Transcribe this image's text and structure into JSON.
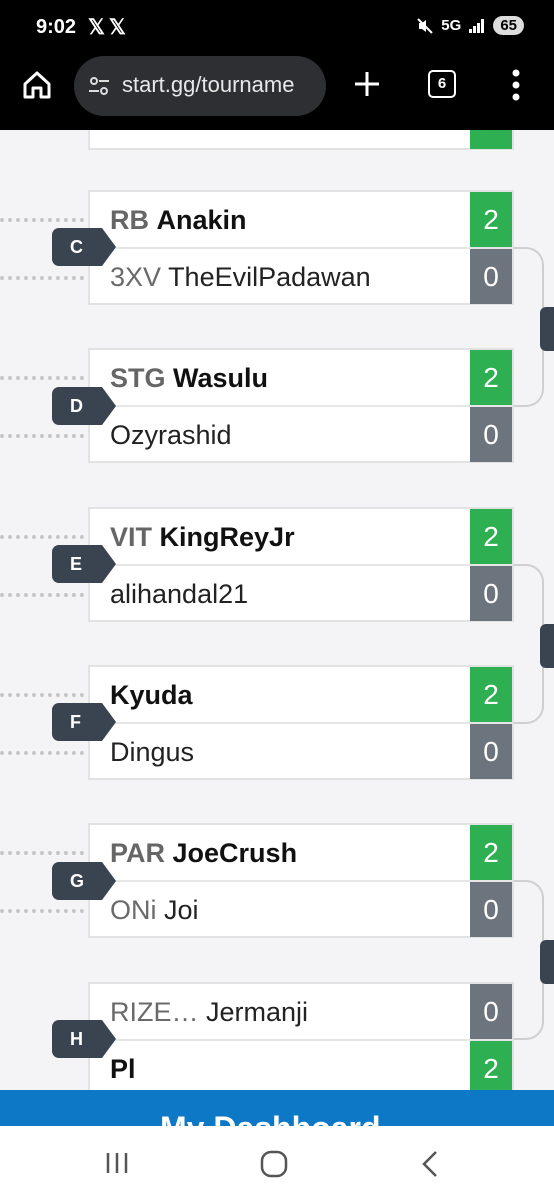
{
  "status_bar": {
    "time": "9:02",
    "x_icons": "𝕏𝕏",
    "network": "5G",
    "battery": "65"
  },
  "browser": {
    "url": "start.gg/tourname",
    "tab_count": "6"
  },
  "matches": [
    {
      "label": "C",
      "p1": {
        "sponsor": "RB",
        "name": "Anakin",
        "score": "2",
        "winner": true
      },
      "p2": {
        "sponsor": "3XV",
        "name": "TheEvilPadawan",
        "score": "0",
        "winner": false
      }
    },
    {
      "label": "D",
      "p1": {
        "sponsor": "STG",
        "name": "Wasulu",
        "score": "2",
        "winner": true
      },
      "p2": {
        "sponsor": "",
        "name": "Ozyrashid",
        "score": "0",
        "winner": false
      }
    },
    {
      "label": "E",
      "p1": {
        "sponsor": "VIT",
        "name": "KingReyJr",
        "score": "2",
        "winner": true
      },
      "p2": {
        "sponsor": "",
        "name": "alihandal21",
        "score": "0",
        "winner": false
      }
    },
    {
      "label": "F",
      "p1": {
        "sponsor": "",
        "name": "Kyuda",
        "score": "2",
        "winner": true
      },
      "p2": {
        "sponsor": "",
        "name": "Dingus",
        "score": "0",
        "winner": false
      }
    },
    {
      "label": "G",
      "p1": {
        "sponsor": "PAR",
        "name": "JoeCrush",
        "score": "2",
        "winner": true
      },
      "p2": {
        "sponsor": "ONi",
        "name": "Joi",
        "score": "0",
        "winner": false
      }
    },
    {
      "label": "H",
      "p1": {
        "sponsor": "RIZE…",
        "name": "Jermanji",
        "score": "0",
        "winner": false
      },
      "p2": {
        "sponsor": "",
        "name": "Pl",
        "score": "2",
        "winner": true
      }
    }
  ],
  "dashboard_button": "My Dashboard",
  "colors": {
    "win": "#2eb052",
    "lose": "#6c757d",
    "label": "#3a4350",
    "dashboard": "#0d78c6"
  }
}
